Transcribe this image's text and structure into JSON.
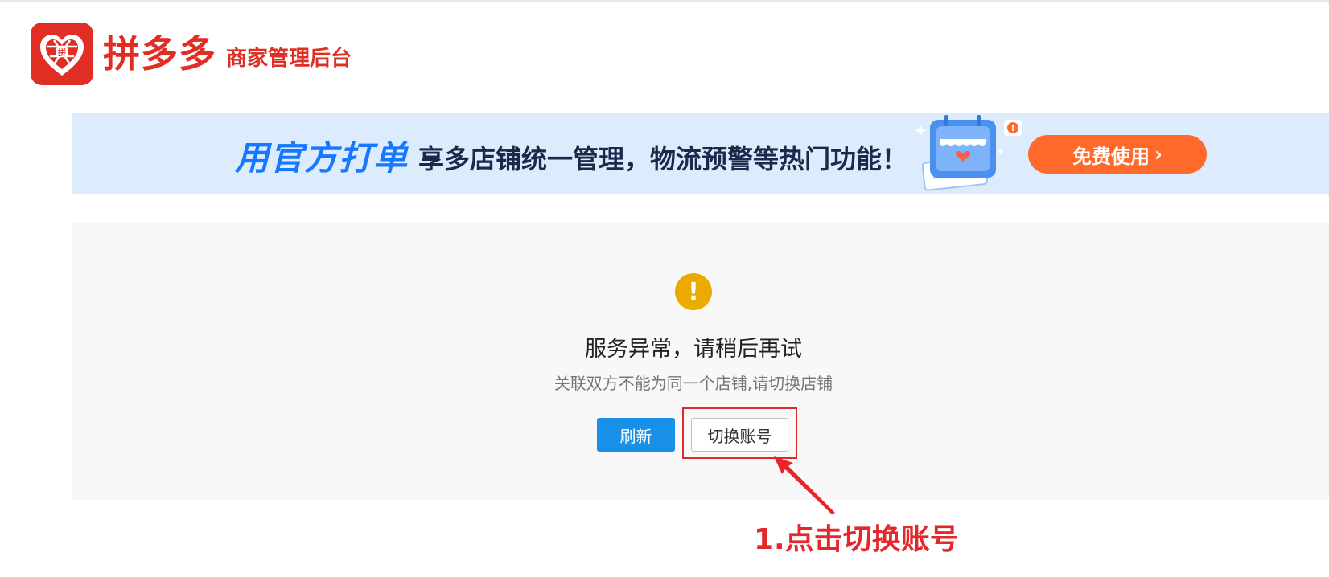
{
  "header": {
    "brand": "拼多多",
    "subtitle": "商家管理后台"
  },
  "banner": {
    "title": "用官方打单",
    "description": "享多店铺统一管理，物流预警等热门功能！",
    "cta_label": "免费使用",
    "cta_chevron": "›",
    "notify_badge": "!"
  },
  "error": {
    "icon_glyph": "!",
    "title": "服务异常，请稍后再试",
    "description": "关联双方不能为同一个店铺,请切换店铺",
    "refresh_label": "刷新",
    "switch_label": "切换账号"
  },
  "annotation": {
    "text": "1.点击切换账号"
  },
  "colors": {
    "brand_red": "#e02e24",
    "banner_bg": "#ddecfd",
    "banner_title_blue": "#1677ff",
    "cta_orange": "#ff6a2a",
    "primary_blue": "#1890e8",
    "warning_yellow": "#ebaa00",
    "annotation_red": "#e5262a"
  },
  "icons": {
    "logo": "pinduoduo-logo-icon",
    "warning": "warning-icon",
    "store": "store-calendar-illustration"
  }
}
